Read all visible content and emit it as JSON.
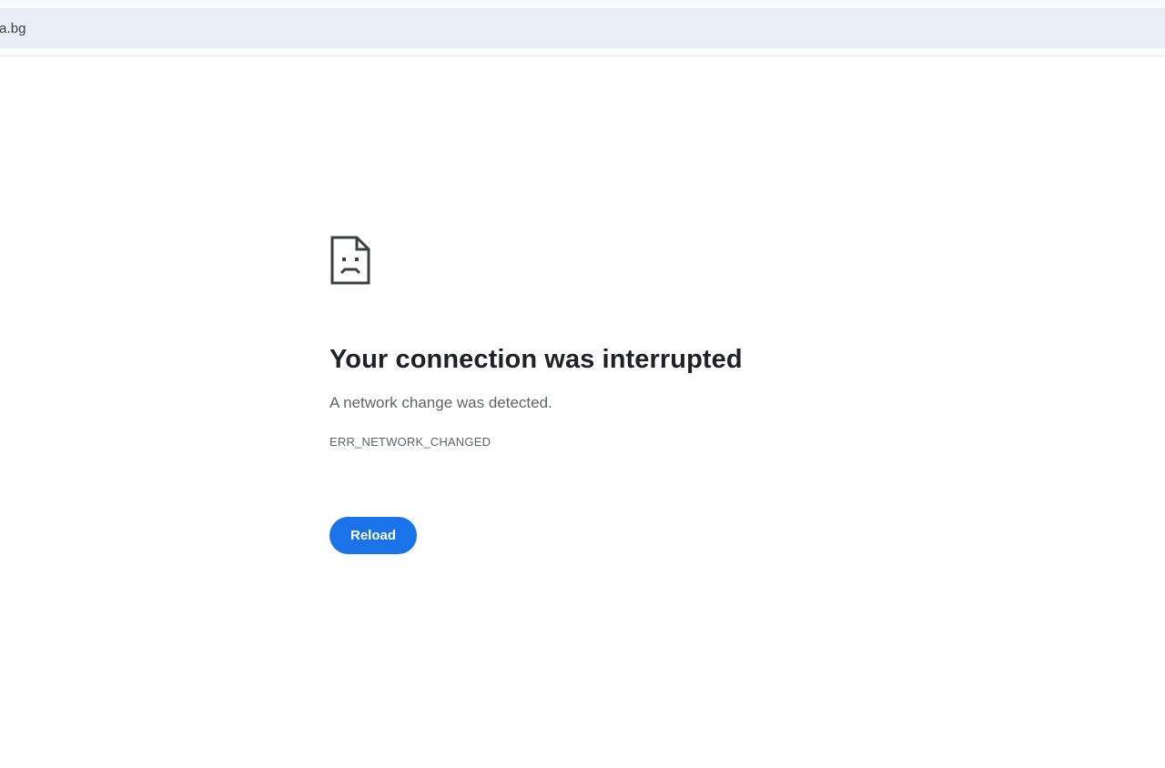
{
  "browser": {
    "address_text": "a.bg"
  },
  "error_page": {
    "icon": "sad-document-icon",
    "title": "Your connection was interrupted",
    "description": "A network change was detected.",
    "error_code": "ERR_NETWORK_CHANGED",
    "reload_label": "Reload"
  },
  "colors": {
    "accent": "#1a73e8",
    "title_text": "#202124",
    "secondary_text": "#5f6368",
    "address_bar_bg": "#e9eef6"
  }
}
